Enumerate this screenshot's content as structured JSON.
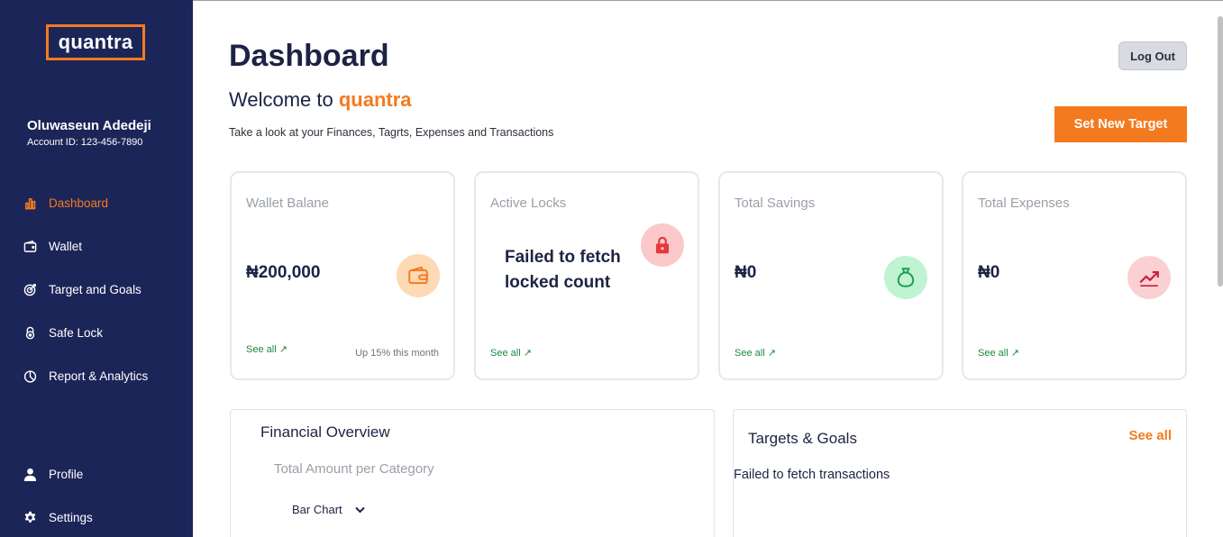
{
  "sidebar": {
    "logo": "quantra",
    "user_name": "Oluwaseun Adedeji",
    "account_id": "Account ID: 123-456-7890",
    "items": [
      {
        "label": "Dashboard",
        "icon": "bar-chart-icon",
        "active": true
      },
      {
        "label": "Wallet",
        "icon": "wallet-icon",
        "active": false
      },
      {
        "label": "Target and Goals",
        "icon": "target-icon",
        "active": false
      },
      {
        "label": "Safe Lock",
        "icon": "lock-icon",
        "active": false
      },
      {
        "label": "Report & Analytics",
        "icon": "pie-chart-icon",
        "active": false
      },
      {
        "label": "Profile",
        "icon": "user-icon",
        "active": false
      },
      {
        "label": "Settings",
        "icon": "gear-icon",
        "active": false
      }
    ]
  },
  "header": {
    "title": "Dashboard",
    "welcome_prefix": "Welcome to ",
    "welcome_brand": "quantra",
    "subtitle": "Take a look at your Finances, Tagrts, Expenses and Transactions",
    "logout_label": "Log Out",
    "set_target_label": "Set New Target"
  },
  "cards": [
    {
      "label": "Wallet Balane",
      "value": "₦200,000",
      "see_all": "See all ↗",
      "trend": "Up 15% this month",
      "icon": "wallet-icon"
    },
    {
      "label": "Active Locks",
      "error": "Failed to fetch locked count",
      "see_all": "See all ↗",
      "icon": "lock-icon"
    },
    {
      "label": "Total Savings",
      "value": "₦0",
      "see_all": "See all ↗",
      "icon": "money-bag-icon"
    },
    {
      "label": "Total Expenses",
      "value": "₦0",
      "see_all": "See all ↗",
      "icon": "trending-up-icon"
    }
  ],
  "financial_overview": {
    "title": "Financial Overview",
    "subtitle": "Total Amount per Category",
    "chart_type_selected": "Bar Chart"
  },
  "targets_goals": {
    "title": "Targets & Goals",
    "see_all": "See all",
    "message": "Failed to fetch transactions"
  },
  "colors": {
    "sidebar_bg": "#1c2558",
    "accent": "#f47a1f",
    "link_green": "#1a8a3e",
    "wallet_circle": "#fdd9b5",
    "lock_circle": "#fbc9c9",
    "savings_circle": "#bff3d2",
    "expenses_circle": "#fbd0d3"
  }
}
